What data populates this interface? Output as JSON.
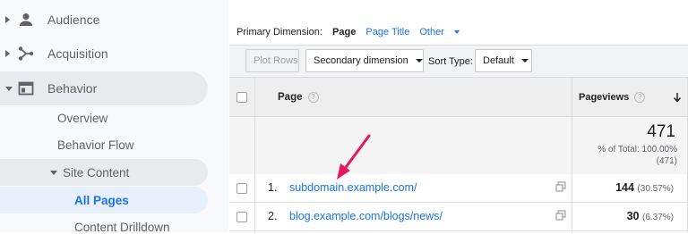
{
  "sidebar": {
    "items": [
      {
        "label": "Audience",
        "icon": "person-icon"
      },
      {
        "label": "Acquisition",
        "icon": "acquisition-icon"
      },
      {
        "label": "Behavior",
        "icon": "behavior-icon"
      }
    ],
    "behavior_sub": [
      "Overview",
      "Behavior Flow"
    ],
    "site_content": "Site Content",
    "site_content_sub": [
      "All Pages",
      "Content Drilldown"
    ]
  },
  "dimensions": {
    "label": "Primary Dimension:",
    "active": "Page",
    "options": [
      "Page Title",
      "Other"
    ]
  },
  "toolbar": {
    "plot_rows": "Plot Rows",
    "secondary": "Secondary dimension",
    "sort_label": "Sort Type:",
    "sort_value": "Default"
  },
  "table": {
    "col_page": "Page",
    "col_pageviews": "Pageviews",
    "total": "471",
    "total_pct": "% of Total: 100.00%",
    "total_abs": "(471)",
    "rows": [
      {
        "num": "1.",
        "page": "subdomain.example.com/",
        "value": "144",
        "pct": "(30.57%)"
      },
      {
        "num": "2.",
        "page": "blog.example.com/blogs/news/",
        "value": "30",
        "pct": "(6.37%)"
      }
    ]
  },
  "colors": {
    "accent": "#1a73e8",
    "arrow": "#e8175d"
  }
}
